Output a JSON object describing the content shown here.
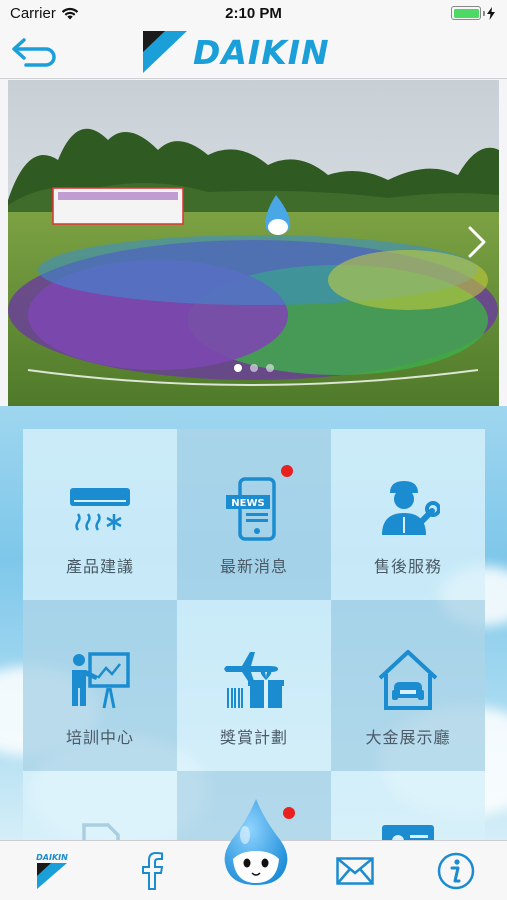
{
  "status_bar": {
    "carrier": "Carrier",
    "time": "2:10 PM"
  },
  "nav": {
    "brand": "DAIKIN",
    "back_icon": "back-arrow-icon"
  },
  "banner": {
    "slide_count": 3,
    "active_slide": 1,
    "next_icon": "chevron-right-icon"
  },
  "menu": {
    "products": {
      "label": "產品建議",
      "icon": "air-conditioner-icon"
    },
    "news": {
      "label": "最新消息",
      "icon": "news-phone-icon",
      "badge": true
    },
    "service": {
      "label": "售後服務",
      "icon": "technician-wrench-icon"
    },
    "training": {
      "label": "培訓中心",
      "icon": "presentation-board-icon"
    },
    "rewards": {
      "label": "獎賞計劃",
      "icon": "plane-gift-icon"
    },
    "showroom": {
      "label": "大金展示廳",
      "icon": "house-sofa-icon"
    }
  },
  "tabbar": {
    "items": [
      "daikin-logo-icon",
      "facebook-icon",
      "mascot-icon",
      "mail-icon",
      "info-icon"
    ],
    "mascot_badge": true
  },
  "colors": {
    "brand_blue": "#1a9fd9",
    "badge_red": "#e8201e",
    "icon_blue": "#1a8ccf"
  }
}
